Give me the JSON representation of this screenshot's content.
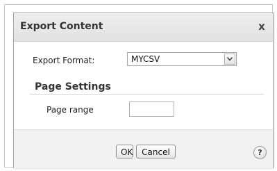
{
  "dialog": {
    "title": "Export Content",
    "close_label": "x"
  },
  "export_format": {
    "label": "Export Format:",
    "selected": "MYCSV"
  },
  "page_settings": {
    "heading": "Page Settings",
    "page_range_label": "Page range",
    "page_range_value": ""
  },
  "footer": {
    "ok_label": "OK",
    "cancel_label": "Cancel",
    "help_label": "?"
  },
  "icons": {
    "dropdown": "chevron-down-icon",
    "help": "help-icon",
    "close": "close-icon"
  }
}
